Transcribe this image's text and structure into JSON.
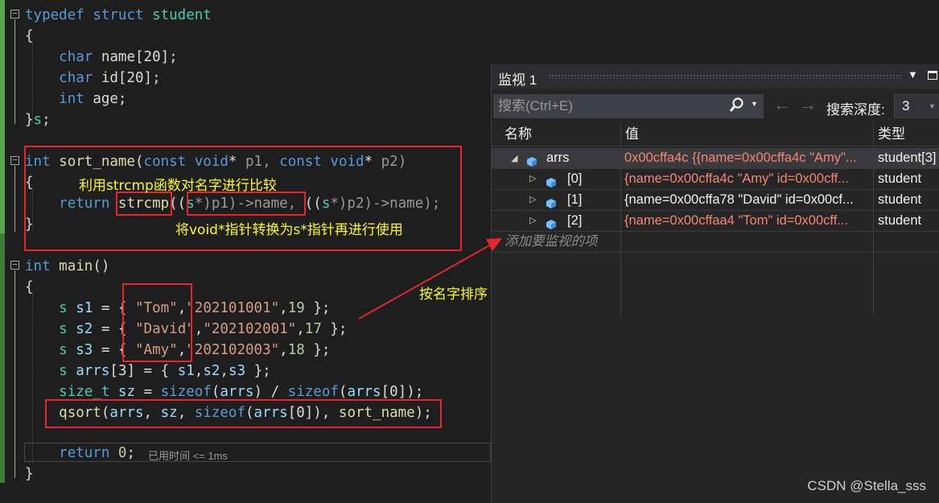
{
  "code": {
    "l1": {
      "kw1": "typedef",
      "kw2": "struct",
      "name": "student"
    },
    "l2": {
      "brace": "{"
    },
    "l3": {
      "kw": "char",
      "rest": "name[20];"
    },
    "l4": {
      "kw": "char",
      "rest": "id[20];"
    },
    "l5": {
      "kw": "int",
      "rest": "age;"
    },
    "l6": {
      "close": "}",
      "s": "s",
      ";": ";"
    },
    "l7": {
      "kw": "int",
      "fn": "sort_name",
      "p0": "(",
      "c1": "const",
      "v1": "void",
      "st1": "*",
      "p1": " p1,",
      "c2": "const",
      "v2": "void",
      "st2": "*",
      "p2": " p2)"
    },
    "l8": {
      "brace": "{"
    },
    "l9": {
      "ret": "return",
      "fn": "strcmp",
      "mid1": "((",
      "t1": "s",
      "cast1": "*)p1)->name,",
      "mid2": " ((",
      "t2": "s",
      "cast2": "*)p2)->name);"
    },
    "l10": {
      "brace": "}"
    },
    "l11": {
      "kw": "int",
      "fn": "main",
      "rest": "()"
    },
    "l12": {
      "brace": "{"
    },
    "l13": {
      "t": "s",
      "v": "s1",
      "eq": " = { ",
      "s1": "\"Tom\"",
      "c": ",",
      "s2": "\"202101001\"",
      "c2": ",",
      "n": "19",
      "end": " };"
    },
    "l14": {
      "t": "s",
      "v": "s2",
      "eq": " = { ",
      "s1": "\"David\"",
      "c": ",",
      "s2": "\"202102001\"",
      "c2": ",",
      "n": "17",
      "end": " };"
    },
    "l15": {
      "t": "s",
      "v": "s3",
      "eq": " = { ",
      "s1": "\"Amy\"",
      "c": ",",
      "s2": "\"202102003\"",
      "c2": ",",
      "n": "18",
      "end": " };"
    },
    "l16": {
      "t": "s",
      "v": "arrs",
      "rest": "[3] = { ",
      "a": "s1",
      "b": "s2",
      "c": "s3",
      "end": " };"
    },
    "l17": {
      "t": "size_t",
      "v": "sz",
      "eq": " = ",
      "f": "sizeof",
      "a": "arrs",
      "sl": ") / ",
      "f2": "sizeof",
      "b": "arrs",
      "end": "[0]);"
    },
    "l18": {
      "f": "qsort",
      "a": "arrs",
      "m1": ", ",
      "b": "sz",
      "m2": ", ",
      "f2": "sizeof",
      "c": "arrs",
      "m3": "[0]), ",
      "d": "sort_name",
      "end": ");"
    },
    "l19": {
      "ret": "return",
      "zero": "0",
      "semi": ";"
    },
    "l20": {
      "brace": "}"
    },
    "timing": "已用时间 <= 1ms"
  },
  "annotations": {
    "strcmp_note": "利用strcmp函数对名字进行比较",
    "cast_note": "将void*指针转换为s*指针再进行使用",
    "sort_note": "按名字排序"
  },
  "watch": {
    "title": "监视 1",
    "search_placeholder": "搜索(Ctrl+E)",
    "depth_label": "搜索深度:",
    "depth_value": "3",
    "col_name": "名称",
    "col_value": "值",
    "col_type": "类型",
    "rows": [
      {
        "name": "arrs",
        "value": "0x00cffa4c {{name=0x00cffa4c \"Amy\"...",
        "type": "student[3]"
      },
      {
        "name": "[0]",
        "value": "{name=0x00cffa4c \"Amy\" id=0x00cff...",
        "type": "student"
      },
      {
        "name": "[1]",
        "value": "{name=0x00cffa78 \"David\" id=0x00cf...",
        "type": "student"
      },
      {
        "name": "[2]",
        "value": "{name=0x00cffaa4 \"Tom\" id=0x00cff...",
        "type": "student"
      }
    ],
    "add_item": "添加要监视的项"
  },
  "watermark": "CSDN @Stella_sss",
  "colors": {
    "accent_red": "#e5262d",
    "annotation": "#ffff00",
    "changed_value": "#f48771"
  }
}
